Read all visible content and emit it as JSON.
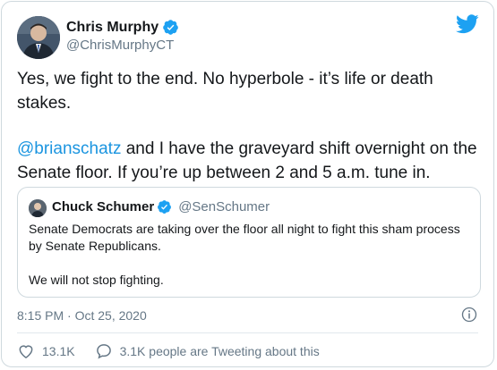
{
  "author": {
    "name": "Chris Murphy",
    "handle": "@ChrisMurphyCT"
  },
  "tweet": {
    "paragraph1": "Yes, we fight to the end. No hyperbole - it’s life or death stakes.",
    "mention": "@brianschatz",
    "paragraph2_rest": " and I have the graveyard shift overnight on the Senate floor. If you’re up between 2 and 5 a.m. tune in."
  },
  "quoted_tweet": {
    "name": "Chuck Schumer",
    "handle": "@SenSchumer",
    "paragraph1": "Senate Democrats are taking over the floor all night to fight this sham process by Senate Republicans.",
    "paragraph2": "We will not stop fighting."
  },
  "timestamp": "8:15 PM · Oct 25, 2020",
  "actions": {
    "likes": "13.1K",
    "conversation": "3.1K people are Tweeting about this"
  },
  "icons": {
    "logo": "twitter-bird-icon",
    "verified": "verified-badge-icon",
    "info": "info-icon",
    "like": "heart-icon",
    "reply": "speech-bubble-icon"
  },
  "colors": {
    "brand": "#1da1f2",
    "link": "#1b95e0",
    "secondary_text": "#657786",
    "border": "#cfd9de"
  }
}
